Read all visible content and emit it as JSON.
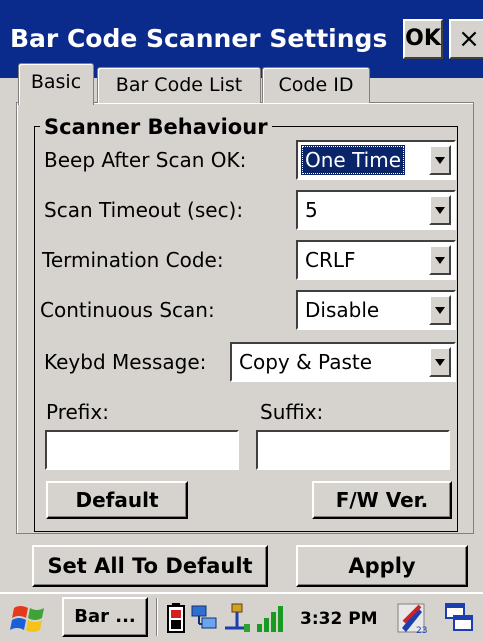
{
  "window": {
    "title": "Bar Code Scanner Settings",
    "ok_label": "OK",
    "close_label": "×"
  },
  "tabs": [
    {
      "label": "Basic",
      "active": true
    },
    {
      "label": "Bar Code List",
      "active": false
    },
    {
      "label": "Code ID",
      "active": false
    }
  ],
  "group": {
    "title": "Scanner Behaviour"
  },
  "fields": {
    "beep": {
      "label": "Beep After Scan OK:",
      "value": "One Time"
    },
    "timeout": {
      "label": "Scan Timeout (sec):",
      "value": "5"
    },
    "termination": {
      "label": "Termination Code:",
      "value": "CRLF"
    },
    "continuous": {
      "label": "Continuous Scan:",
      "value": "Disable"
    },
    "keybd": {
      "label": "Keybd Message:",
      "value": "Copy & Paste"
    },
    "prefix": {
      "label": "Prefix:",
      "value": ""
    },
    "suffix": {
      "label": "Suffix:",
      "value": ""
    }
  },
  "buttons": {
    "default": "Default",
    "fw_ver": "F/W Ver.",
    "set_all_default": "Set All To Default",
    "apply": "Apply"
  },
  "taskbar": {
    "app_button": "Bar ...",
    "clock": "3:32 PM",
    "icons": [
      "windows-start-icon",
      "battery-icon",
      "network-icon",
      "usb-icon",
      "signal-strength-icon",
      "input-panel-icon",
      "switch-window-icon"
    ]
  },
  "colors": {
    "title_bar": "#0a2a8c",
    "window_bg": "#d6d3ce",
    "selection": "#0a246a"
  }
}
